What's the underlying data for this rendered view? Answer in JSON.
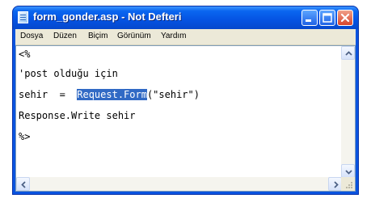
{
  "window": {
    "title": "form_gonder.asp - Not Defteri",
    "icon": "notepad-icon"
  },
  "title_buttons": {
    "minimize_icon": "minimize-icon",
    "maximize_icon": "maximize-icon",
    "close_icon": "close-icon"
  },
  "menu": {
    "items": [
      "Dosya",
      "Düzen",
      "Biçim",
      "Görünüm",
      "Yardım"
    ]
  },
  "editor": {
    "line1": "<%",
    "line2": "'post olduğu için",
    "line3_before": "sehir  =  ",
    "line3_selected": "Request.Form",
    "line3_after": "(\"sehir\")",
    "line4": "Response.Write sehir",
    "line5": "%>"
  },
  "colors": {
    "selection": "#316ac5",
    "titlebar": "#0553e2",
    "menubar": "#ece9d8"
  }
}
